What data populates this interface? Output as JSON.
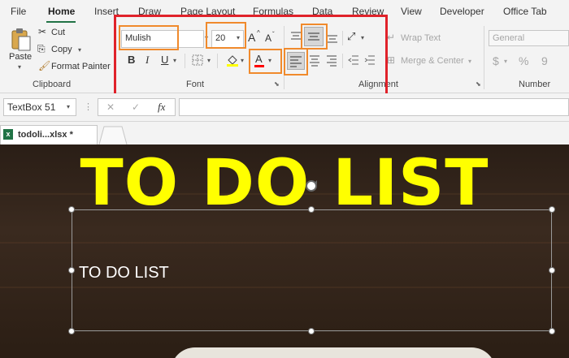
{
  "menu": {
    "tabs": [
      "File",
      "Home",
      "Insert",
      "Draw",
      "Page Layout",
      "Formulas",
      "Data",
      "Review",
      "View",
      "Developer",
      "Office Tab"
    ]
  },
  "clipboard": {
    "paste": "Paste",
    "cut": "Cut",
    "copy": "Copy",
    "format_painter": "Format Painter",
    "label": "Clipboard"
  },
  "font": {
    "name": "Mulish",
    "size": "20",
    "grow": "A",
    "shrink": "A",
    "bold": "B",
    "italic": "I",
    "underline": "U",
    "font_color": "A",
    "label": "Font"
  },
  "alignment": {
    "wrap_text": "Wrap Text",
    "merge_center": "Merge & Center",
    "label": "Alignment"
  },
  "number": {
    "format": "General",
    "currency": "$",
    "percent": "%",
    "comma": "9",
    "label": "Number"
  },
  "formula_bar": {
    "name_box": "TextBox 51",
    "cancel": "✕",
    "enter": "✓",
    "fx": "fx",
    "value": ""
  },
  "workbook_tab": {
    "label": "todoli...xlsx *"
  },
  "sheet": {
    "banner_text": "TO DO LIST",
    "textbox_text": "TO DO LIST"
  },
  "colors": {
    "banner": "#ffff00",
    "highlight_red": "#e0222a",
    "highlight_orange": "#f08a2c",
    "excel_green": "#217346"
  }
}
